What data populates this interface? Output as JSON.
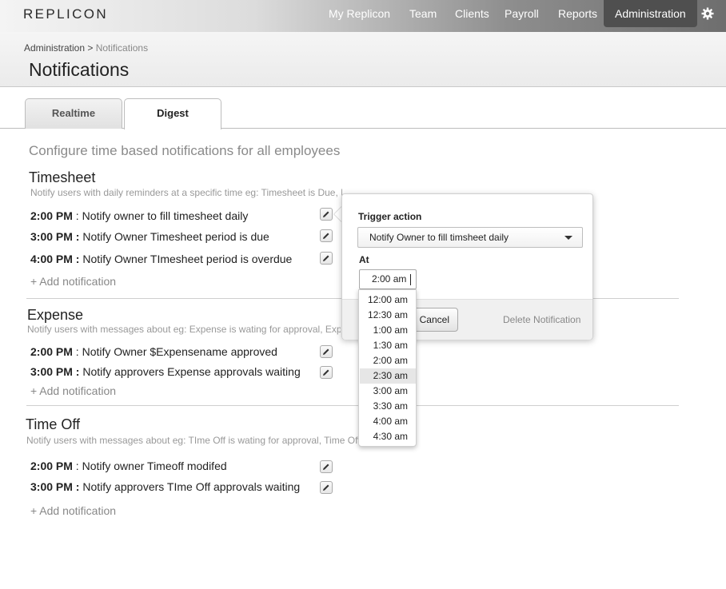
{
  "app": {
    "logo": "REPLICON"
  },
  "nav": {
    "items": [
      "My Replicon",
      "Team",
      "Clients",
      "Payroll",
      "Reports",
      "Administration"
    ],
    "active": "Administration"
  },
  "breadcrumb": {
    "parent": "Administration >",
    "current": "Notifications"
  },
  "page_title": "Notifications",
  "tabs": [
    {
      "label": "Realtime"
    },
    {
      "label": "Digest"
    }
  ],
  "active_tab": "Digest",
  "configure_text": "Configure time based notifications for all employees",
  "sections": [
    {
      "title": "Timesheet",
      "desc": "Notify users with daily reminders at a specific time eg: Timesheet is Due, Fill your Timesheet",
      "rows": [
        {
          "time": "2:00 PM",
          "sep": " : ",
          "text": "Notify owner to fill timesheet daily"
        },
        {
          "time": "3:00 PM :",
          "sep": " ",
          "text": "Notify Owner Timesheet period is due"
        },
        {
          "time": "4:00 PM :",
          "sep": " ",
          "text": "Notify Owner TImesheet period is overdue"
        }
      ],
      "add": "+ Add notification"
    },
    {
      "title": "Expense",
      "desc": "Notify users with messages about eg: Expense is wating for approval, Expense approved",
      "rows": [
        {
          "time": "2:00 PM",
          "sep": " : ",
          "text": "Notify Owner $Expensename approved"
        },
        {
          "time": "3:00 PM :",
          "sep": " ",
          "text": "Notify approvers Expense approvals waiting"
        }
      ],
      "add": "+ Add notification"
    },
    {
      "title": "Time Off",
      "desc": "Notify users with messages about eg: TIme Off is wating for approval, Time Off approved",
      "rows": [
        {
          "time": "2:00 PM",
          "sep": " : ",
          "text": "Notify owner Timeoff modifed"
        },
        {
          "time": "3:00 PM :",
          "sep": " ",
          "text": "Notify approvers TIme Off approvals waiting"
        }
      ],
      "add": "+ Add notification"
    }
  ],
  "popover": {
    "trigger_label": "Trigger action",
    "trigger_value": "Notify Owner to fill timsheet daily",
    "at_label": "At",
    "time_value": "2:00 am",
    "cancel": "Cancel",
    "delete": "Delete Notification"
  },
  "time_options": [
    "12:00 am",
    "12:30 am",
    "1:00 am",
    "1:30 am",
    "2:00 am",
    "2:30 am",
    "3:00 am",
    "3:30 am",
    "4:00 am",
    "4:30 am"
  ],
  "highlighted_option": "2:30 am"
}
